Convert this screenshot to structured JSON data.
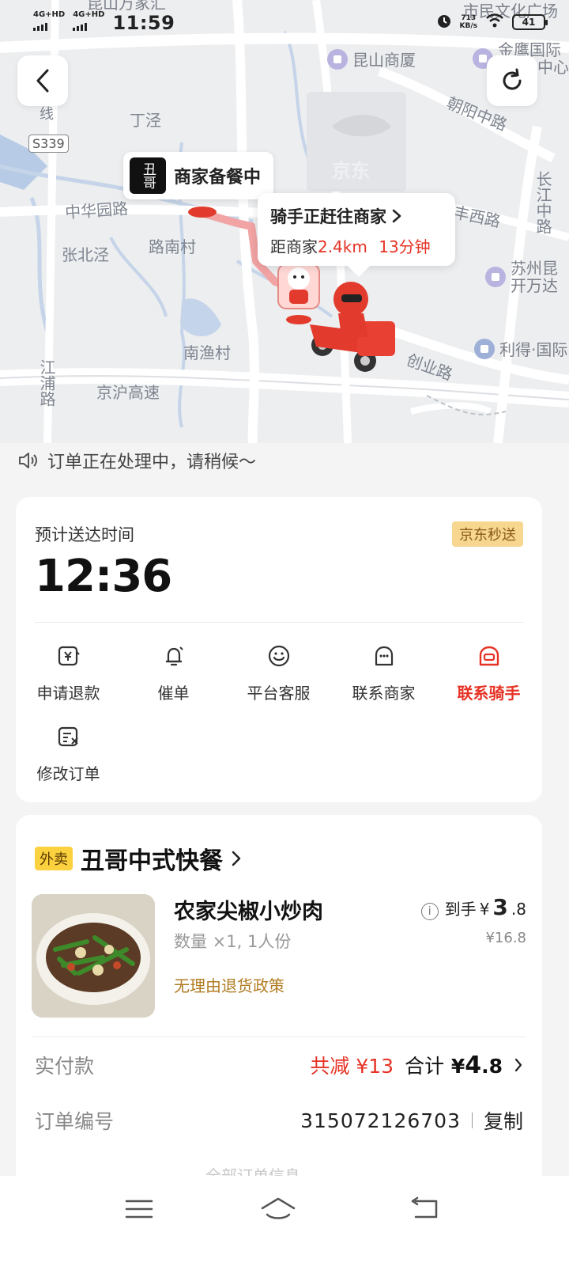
{
  "status_bar": {
    "network1": "4G+HD",
    "network2": "4G+HD",
    "time": "11:59",
    "speed_value": "713",
    "speed_unit": "KB/s",
    "battery": "41"
  },
  "map": {
    "labels": {
      "dingjing": "丁泾",
      "zhonghualu": "中华园路",
      "zhangbeijing": "张北泾",
      "lunancun": "路南村",
      "nanyucun": "南渔村",
      "jinghugaosu": "京沪高速",
      "chuangyelu": "创业路",
      "chaoyangzhonglu": "朝阳中路",
      "fengxilu": "丰西路",
      "changjiangzhonglu": "长江中路",
      "jiangpulu": "江浦路",
      "xian": "线",
      "highway": "S339",
      "jd_watermark": "京东"
    },
    "pois": {
      "kunshan": "昆山商厦",
      "jinying": "金鹰国际",
      "jinying_line2": "中心",
      "suzhou": "苏州昆",
      "suzhou_line2": "开万达",
      "lide": "利得·国际",
      "shimin": "市民文化广场",
      "top_cut": "昆山万家汇"
    }
  },
  "merchant_bubble": {
    "logo_text": "丑哥",
    "status": "商家备餐中"
  },
  "rider_bubble": {
    "title": "骑手正赶往商家",
    "distance_prefix": "距商家",
    "distance": "2.4km",
    "eta": "13分钟"
  },
  "notice": "订单正在处理中，请稍候～",
  "delivery_card": {
    "eta_label": "预计送达时间",
    "eta_time": "12:36",
    "badge": "京东秒送",
    "actions": [
      {
        "label": "申请退款",
        "icon": "refund-icon"
      },
      {
        "label": "催单",
        "icon": "bell-icon"
      },
      {
        "label": "平台客服",
        "icon": "smile-icon"
      },
      {
        "label": "联系商家",
        "icon": "merchant-chat-icon"
      },
      {
        "label": "联系骑手",
        "icon": "helmet-icon"
      },
      {
        "label": "修改订单",
        "icon": "edit-order-icon"
      }
    ],
    "accent_color": "#e63325"
  },
  "order_card": {
    "tag": "外卖",
    "shop_name": "丑哥中式快餐",
    "item": {
      "name": "农家尖椒小炒肉",
      "qty": "数量 ×1, 1人份",
      "policy": "无理由退货政策",
      "price_prefix": "到手",
      "price_currency": "¥",
      "price_int": "3",
      "price_dec": ".8",
      "orig_price": "¥16.8"
    },
    "payment_label": "实付款",
    "discount": "共减 ¥13",
    "total_prefix": "合计",
    "total_currency": "¥",
    "total_int": "4",
    "total_dec": ".8",
    "order_no_label": "订单编号",
    "order_no": "315072126703",
    "copy": "复制",
    "faded": "全部订单信息"
  }
}
